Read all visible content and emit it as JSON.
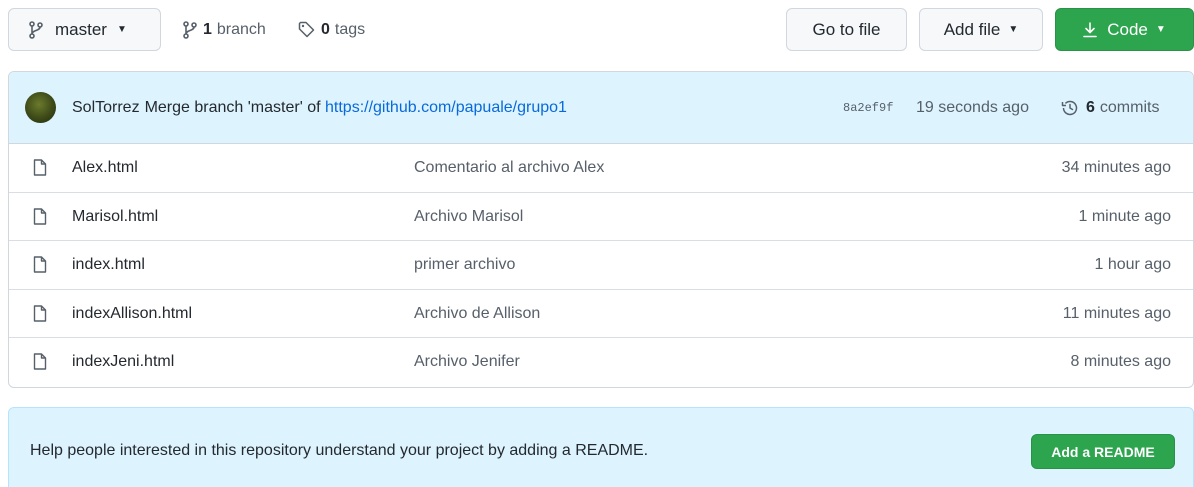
{
  "toolbar": {
    "branch_button": {
      "label": "master",
      "icon": "git-branch-icon"
    },
    "branches": {
      "count": "1",
      "label": "branch",
      "icon": "git-branch-icon"
    },
    "tags": {
      "count": "0",
      "label": "tags",
      "icon": "tag-icon"
    },
    "go_to_file_label": "Go to file",
    "add_file_label": "Add file",
    "code_label": "Code"
  },
  "latest_commit": {
    "author": "SolTorrez",
    "message": "Merge branch 'master' of",
    "link": "https://github.com/papuale/grupo1",
    "sha": "8a2ef9f",
    "age": "19 seconds ago",
    "commits_count": "6",
    "commits_label": "commits"
  },
  "files": [
    {
      "name": "Alex.html",
      "message": "Comentario al archivo Alex",
      "age": "34 minutes ago"
    },
    {
      "name": "Marisol.html",
      "message": "Archivo Marisol",
      "age": "1 minute ago"
    },
    {
      "name": "index.html",
      "message": "primer archivo",
      "age": "1 hour ago"
    },
    {
      "name": "indexAllison.html",
      "message": "Archivo de Allison",
      "age": "11 minutes ago"
    },
    {
      "name": "indexJeni.html",
      "message": "Archivo Jenifer",
      "age": "8 minutes ago"
    }
  ],
  "readme_banner": {
    "text": "Help people interested in this repository understand your project by adding a README.",
    "button_label": "Add a README"
  },
  "colors": {
    "primary_green": "#2da44e",
    "link_blue": "#0969da",
    "banner_blue": "#ddf4ff"
  }
}
